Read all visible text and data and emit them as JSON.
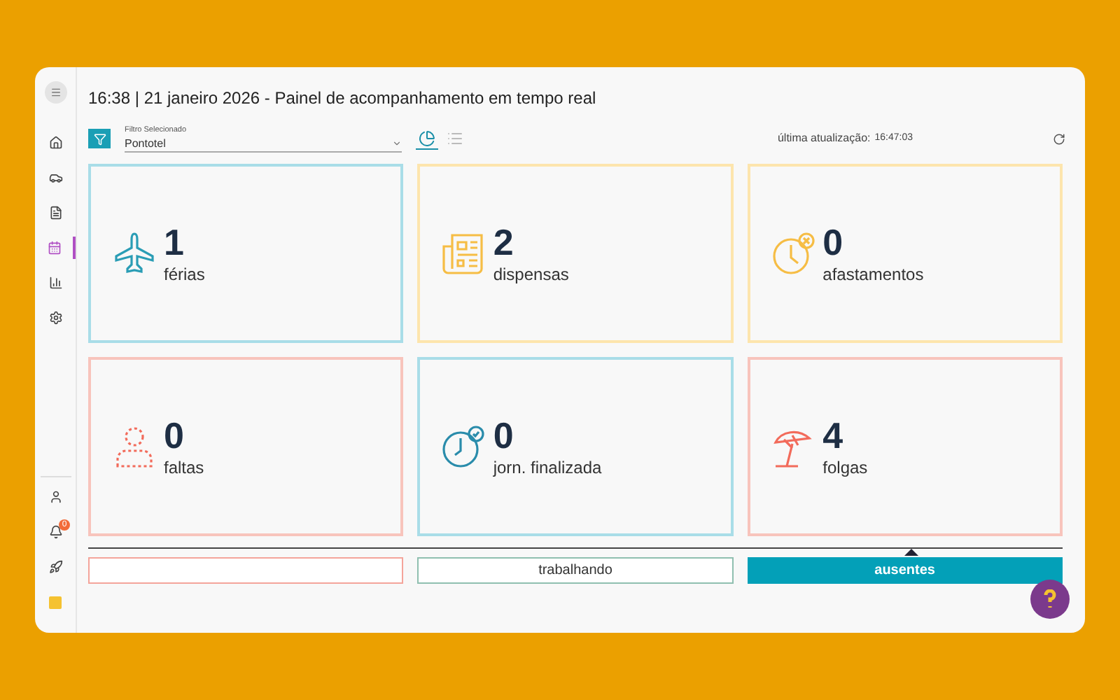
{
  "header": {
    "title": "16:38 | 21 janeiro 2026 - Painel de acompanhamento em tempo real"
  },
  "sidebar": {
    "items": [
      {
        "kind": "home",
        "selected": false
      },
      {
        "kind": "car",
        "selected": false
      },
      {
        "kind": "doc",
        "selected": false
      },
      {
        "kind": "calendar",
        "selected": true
      },
      {
        "kind": "chart",
        "selected": false
      },
      {
        "kind": "gear",
        "selected": false
      }
    ],
    "bottom_items": [
      {
        "kind": "user"
      },
      {
        "kind": "bell",
        "badge": "0"
      },
      {
        "kind": "rocket"
      },
      {
        "kind": "note"
      }
    ]
  },
  "filter": {
    "label": "Filtro Selecionado",
    "value": "Pontotel"
  },
  "view_toggle": [
    {
      "kind": "chart",
      "selected": true
    },
    {
      "kind": "list",
      "selected": false
    }
  ],
  "last_update": {
    "label": "última atualização:",
    "time": "16:47:03"
  },
  "cards": [
    {
      "kind": "plane",
      "value": "1",
      "label": "férias",
      "color": "#a9dde8"
    },
    {
      "kind": "newspaper",
      "value": "2",
      "label": "dispensas",
      "color": "#fde5ad"
    },
    {
      "kind": "clock-x",
      "value": "0",
      "label": "afastamentos",
      "color": "#fde5ad"
    },
    {
      "kind": "person",
      "value": "0",
      "label": "faltas",
      "color": "#f8c4bc"
    },
    {
      "kind": "clock-check",
      "value": "0",
      "label": "jorn. finalizada",
      "color": "#a9dde8"
    },
    {
      "kind": "umbrella",
      "value": "4",
      "label": "folgas",
      "color": "#f8c4bc"
    }
  ],
  "tabs": [
    {
      "selected": false,
      "color": "#f4a49a"
    },
    {
      "label": "trabalhando",
      "selected": false,
      "color": "#8fbfb0"
    },
    {
      "label": "ausentes",
      "selected": true,
      "color": "#03a0b8"
    }
  ]
}
